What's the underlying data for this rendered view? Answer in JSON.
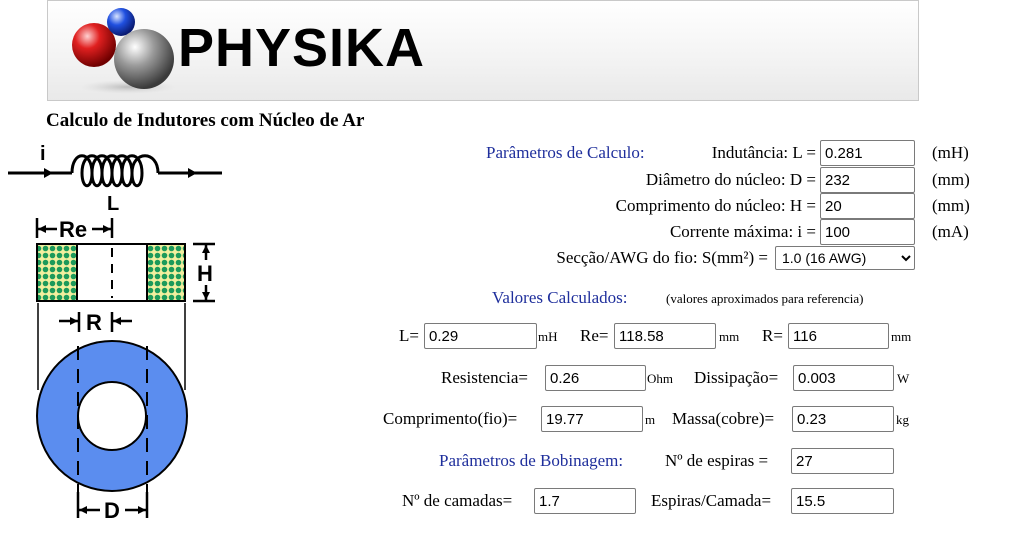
{
  "header": {
    "logo_text": "PHYSIKA"
  },
  "title": "Calculo de Indutores com Núcleo de Ar",
  "diagram": {
    "label_i": "i",
    "label_L": "L",
    "label_Re": "Re",
    "label_H": "H",
    "label_R": "R",
    "label_D": "D"
  },
  "params": {
    "section_label": "Parâmetros de Calculo:",
    "inductance": {
      "label": "Indutância: L =",
      "value": "0.281",
      "unit": "(mH)"
    },
    "diameter": {
      "label": "Diâmetro do núcleo: D =",
      "value": "232",
      "unit": "(mm)"
    },
    "length": {
      "label": "Comprimento do núcleo: H =",
      "value": "20",
      "unit": "(mm)"
    },
    "current": {
      "label": "Corrente máxima: i =",
      "value": "100",
      "unit": "(mA)"
    },
    "wire": {
      "label": "Secção/AWG do fio: S(mm²) =",
      "selected": "1.0 (16 AWG)"
    }
  },
  "results": {
    "section_label": "Valores Calculados:",
    "note": "(valores aproximados para referencia)",
    "L": {
      "label": "L=",
      "value": "0.29",
      "unit": "mH"
    },
    "Re": {
      "label": "Re=",
      "value": "118.58",
      "unit": "mm"
    },
    "R": {
      "label": "R=",
      "value": "116",
      "unit": "mm"
    },
    "resistance": {
      "label": "Resistencia=",
      "value": "0.26",
      "unit": "Ohm"
    },
    "dissipation": {
      "label": "Dissipação=",
      "value": "0.003",
      "unit": "W"
    },
    "wire_length": {
      "label": "Comprimento(fio)=",
      "value": "19.77",
      "unit": "m"
    },
    "mass": {
      "label": "Massa(cobre)=",
      "value": "0.23",
      "unit": "kg"
    }
  },
  "winding": {
    "section_label": "Parâmetros de Bobinagem:",
    "turns": {
      "label": "Nº de espiras =",
      "value": "27"
    },
    "layers": {
      "label": "Nº de camadas=",
      "value": "1.7"
    },
    "per_layer": {
      "label": "Espiras/Camada=",
      "value": "15.5"
    }
  },
  "colors": {
    "section_blue": "#1f2f9c",
    "core_blue": "#5b8def",
    "winding_green": "#1c9a5a",
    "winding_yellow": "#f2ef9e"
  }
}
